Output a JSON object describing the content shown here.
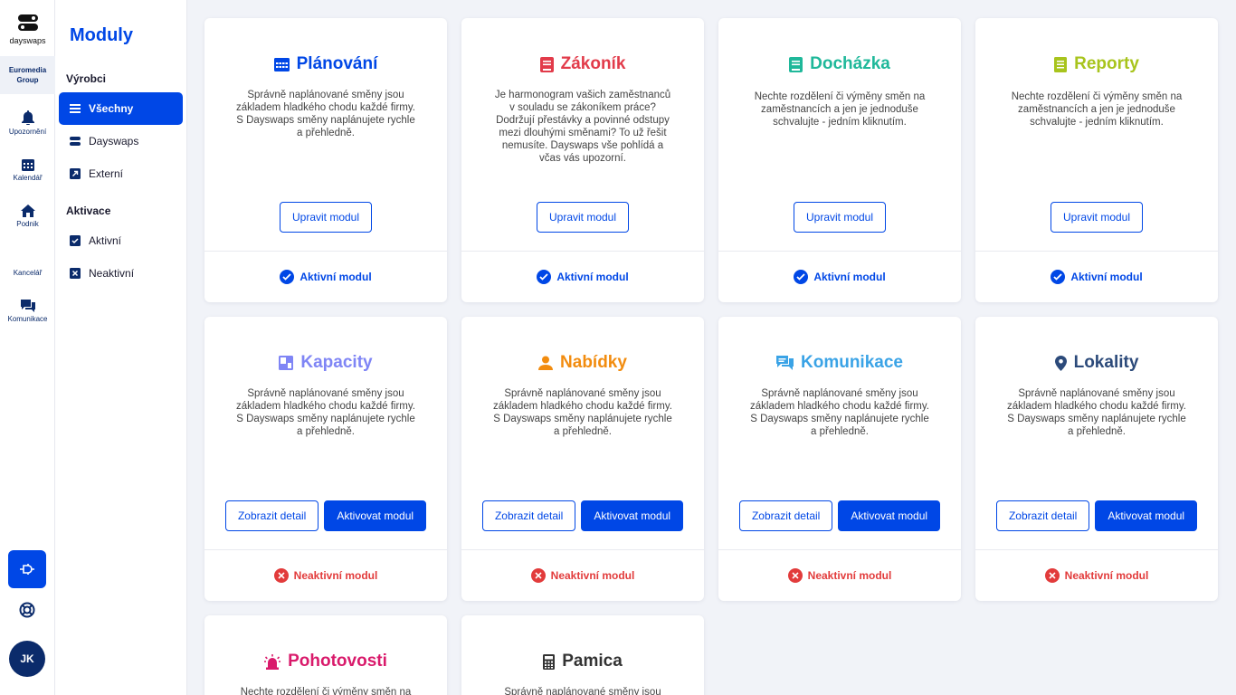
{
  "rail": {
    "logo_text": "dayswaps",
    "org": [
      "Euromedia",
      "Group"
    ],
    "items": [
      {
        "label": "Upozornění",
        "icon": "bell-icon"
      },
      {
        "label": "Kalendář",
        "icon": "calendar-icon"
      },
      {
        "label": "Podnik",
        "icon": "home-icon"
      },
      {
        "label": "Kancelář",
        "icon": ""
      },
      {
        "label": "Komunikace",
        "icon": "chat-icon"
      }
    ],
    "avatar": "JK"
  },
  "sidebar": {
    "title": "Moduly",
    "section1": "Výrobci",
    "items1": [
      {
        "label": "Všechny",
        "icon": "list-icon"
      },
      {
        "label": "Dayswaps",
        "icon": "dayswaps-icon"
      },
      {
        "label": "Externí",
        "icon": "external-icon"
      }
    ],
    "section2": "Aktivace",
    "items2": [
      {
        "label": "Aktivní",
        "icon": "checkbox-icon"
      },
      {
        "label": "Neaktivní",
        "icon": "x-box-icon"
      }
    ]
  },
  "buttons": {
    "edit": "Upravit modul",
    "detail": "Zobrazit detail",
    "activate": "Aktivovat modul"
  },
  "status": {
    "active": "Aktivní modul",
    "inactive": "Neaktivní modul"
  },
  "colors": {
    "primary": "#0047e6",
    "planovani": "#0047e6",
    "zakonik": "#e23b4a",
    "dochazka": "#1fb89a",
    "reporty": "#a8c41d",
    "kapacity": "#7f85f5",
    "nabidky": "#f28c0f",
    "komunikace": "#3aa3e6",
    "lokality": "#2c4a7a",
    "pohotovosti": "#d91a6b",
    "pamica": "#333333",
    "inactive": "#e23b3b"
  },
  "modules": [
    {
      "title": "Plánování",
      "icon": "calendar-icon",
      "desc": "Správně naplánované směny jsou základem hladkého chodu každé firmy. S Dayswaps směny naplánujete rychle a přehledně.",
      "active": true
    },
    {
      "title": "Zákoník",
      "icon": "book-icon",
      "desc": "Je harmonogram vašich zaměstnanců v souladu se zákoníkem práce? Dodržují přestávky a povinné odstupy mezi dlouhými směnami? To už řešit nemusíte. Dayswaps vše pohlídá a včas vás upozorní.",
      "active": true
    },
    {
      "title": "Docházka",
      "icon": "book-icon",
      "desc": "Nechte rozdělení či výměny směn na zaměstnancích a jen je jednoduše schvalujte - jedním kliknutím.",
      "active": true
    },
    {
      "title": "Reporty",
      "icon": "document-icon",
      "desc": "Nechte rozdělení či výměny směn na zaměstnancích a jen je jednoduše schvalujte - jedním kliknutím.",
      "active": true
    },
    {
      "title": "Kapacity",
      "icon": "dashboard-icon",
      "desc": "Správně naplánované směny jsou základem hladkého chodu každé firmy. S Dayswaps směny naplánujete rychle a přehledně.",
      "active": false
    },
    {
      "title": "Nabídky",
      "icon": "person-icon",
      "desc": "Správně naplánované směny jsou základem hladkého chodu každé firmy. S Dayswaps směny naplánujete rychle a přehledně.",
      "active": false
    },
    {
      "title": "Komunikace",
      "icon": "chat-icon",
      "desc": "Správně naplánované směny jsou základem hladkého chodu každé firmy. S Dayswaps směny naplánujete rychle a přehledně.",
      "active": false
    },
    {
      "title": "Lokality",
      "icon": "pin-icon",
      "desc": "Správně naplánované směny jsou základem hladkého chodu každé firmy. S Dayswaps směny naplánujete rychle a přehledně.",
      "active": false
    },
    {
      "title": "Pohotovosti",
      "icon": "siren-icon",
      "desc": "Nechte rozdělení či výměny směn na",
      "active": null
    },
    {
      "title": "Pamica",
      "icon": "calculator-icon",
      "desc": "Správně naplánované směny jsou",
      "active": null
    }
  ]
}
